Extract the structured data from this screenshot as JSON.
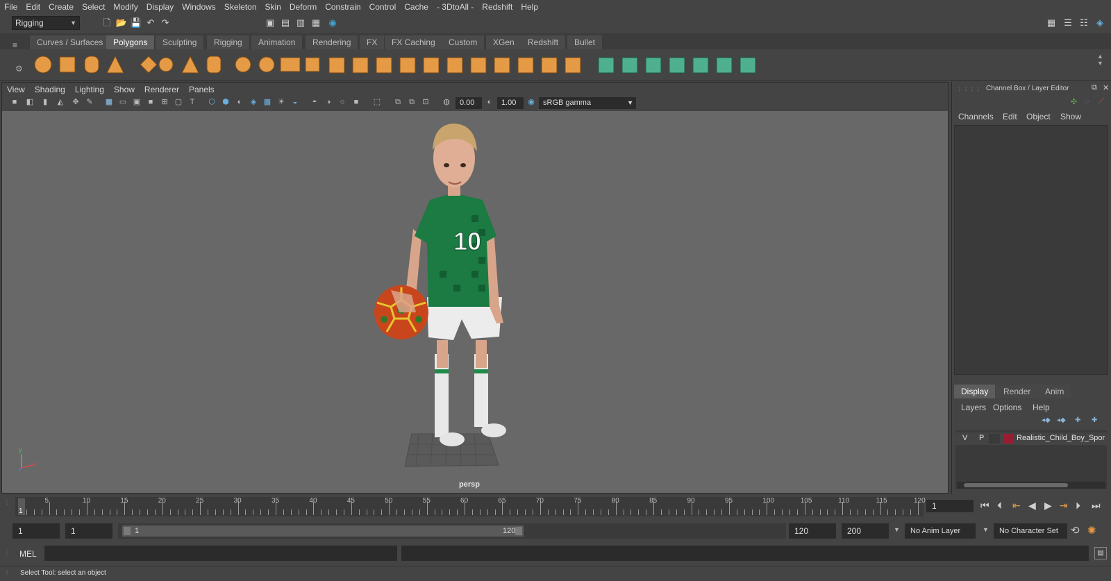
{
  "menubar": [
    "File",
    "Edit",
    "Create",
    "Select",
    "Modify",
    "Display",
    "Windows",
    "Skeleton",
    "Skin",
    "Deform",
    "Constrain",
    "Control",
    "Cache",
    "- 3DtoAll -",
    "Redshift",
    "Help"
  ],
  "mode_selector": "Rigging",
  "shelf_tabs": [
    "Curves / Surfaces",
    "Polygons",
    "Sculpting",
    "Rigging",
    "Animation",
    "Rendering",
    "FX",
    "FX Caching",
    "Custom",
    "XGen",
    "Redshift",
    "Bullet"
  ],
  "active_shelf_tab": "Polygons",
  "panel_menu": [
    "View",
    "Shading",
    "Lighting",
    "Show",
    "Renderer",
    "Panels"
  ],
  "viewport_toolbar": {
    "exposure": "0.00",
    "gamma": "1.00",
    "color_space": "sRGB gamma"
  },
  "viewport": {
    "camera_label": "persp",
    "axis_y": "y",
    "axis_x": "x"
  },
  "channel_box": {
    "title": "Channel Box / Layer Editor",
    "menu": [
      "Channels",
      "Edit",
      "Object",
      "Show"
    ]
  },
  "layer_editor": {
    "tabs": [
      "Display",
      "Render",
      "Anim"
    ],
    "active_tab": "Display",
    "menu": [
      "Layers",
      "Options",
      "Help"
    ],
    "layer": {
      "v": "V",
      "p": "P",
      "name": "Realistic_Child_Boy_Spor",
      "color": "#9b1b32"
    }
  },
  "timeline": {
    "ticks": [
      "5",
      "10",
      "15",
      "20",
      "25",
      "30",
      "35",
      "40",
      "45",
      "50",
      "55",
      "60",
      "65",
      "70",
      "75",
      "80",
      "85",
      "90",
      "95",
      "100",
      "105",
      "110",
      "115",
      "120"
    ],
    "current_frame_marker": "1",
    "current_frame_field": "1"
  },
  "range_slider": {
    "start": "1",
    "anim_start": "1",
    "slider_start": "1",
    "slider_end": "120",
    "end": "120",
    "anim_end": "200",
    "anim_layer": "No Anim Layer",
    "character_set": "No Character Set"
  },
  "command_line": {
    "label": "MEL"
  },
  "help_line": "Select Tool: select an object",
  "colors": {
    "ui_bg": "#444444",
    "viewport_bg": "#686868",
    "shelf_orange": "#e59a45",
    "shelf_green": "#4fb08f"
  }
}
